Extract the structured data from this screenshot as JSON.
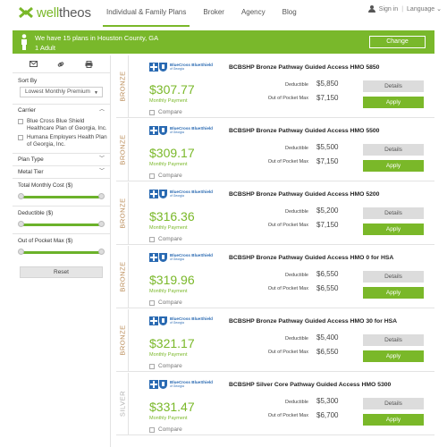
{
  "header": {
    "logo_text_w": "well",
    "logo_text_t": "theos",
    "nav": [
      "Individual & Family Plans",
      "Broker",
      "Agency",
      "Blog"
    ],
    "sign_in": "Sign in",
    "language": "Language ⌄"
  },
  "banner": {
    "line1": "We have 15 plans in Houston County, GA",
    "line2": "1 Adult",
    "change": "Change"
  },
  "sidebar": {
    "sort_by": "Sort By",
    "sort_value": "Lowest Monthly Premium",
    "carrier": "Carrier",
    "carriers": [
      "Blue Cross Blue Shield Healthcare Plan of Georgia, Inc.",
      "Humana Employers Health Plan of Georgia, Inc."
    ],
    "plan_type": "Plan Type",
    "metal_tier": "Metal Tier",
    "total_cost": "Total Monthly Cost ($)",
    "deductible": "Deductible ($)",
    "oop": "Out of Pocket Max ($)",
    "reset": "Reset"
  },
  "card_labels": {
    "monthly_payment": "Monthly Payment",
    "compare": "Compare",
    "deductible": "Deductible",
    "oop": "Out of Pocket Max",
    "details": "Details",
    "apply": "Apply",
    "bcbs_l1": "BlueCross BlueShield",
    "bcbs_l2": "of Georgia"
  },
  "plans": [
    {
      "metal": "BRONZE",
      "name": "BCBSHP Bronze Pathway Guided Access HMO 5850",
      "price": "$307.77",
      "deductible": "$5,850",
      "oop": "$7,150"
    },
    {
      "metal": "BRONZE",
      "name": "BCBSHP Bronze Pathway Guided Access HMO 5500",
      "price": "$309.17",
      "deductible": "$5,500",
      "oop": "$7,150"
    },
    {
      "metal": "BRONZE",
      "name": "BCBSHP Bronze Pathway Guided Access HMO 5200",
      "price": "$316.36",
      "deductible": "$5,200",
      "oop": "$7,150"
    },
    {
      "metal": "BRONZE",
      "name": "BCBSHP Bronze Pathway Guided Access HMO 0 for HSA",
      "price": "$319.96",
      "deductible": "$6,550",
      "oop": "$6,550"
    },
    {
      "metal": "BRONZE",
      "name": "BCBSHP Bronze Pathway Guided Access HMO 30 for HSA",
      "price": "$321.17",
      "deductible": "$5,400",
      "oop": "$6,550"
    },
    {
      "metal": "SILVER",
      "name": "BCBSHP Silver Core Pathway Guided Access HMO 5300",
      "price": "$331.47",
      "deductible": "$5,300",
      "oop": "$6,700"
    }
  ],
  "colors": {
    "accent": "#7ab829",
    "bronze": "#b98a55",
    "silver": "#b0b0b0",
    "bcbs": "#2a6ab2"
  }
}
